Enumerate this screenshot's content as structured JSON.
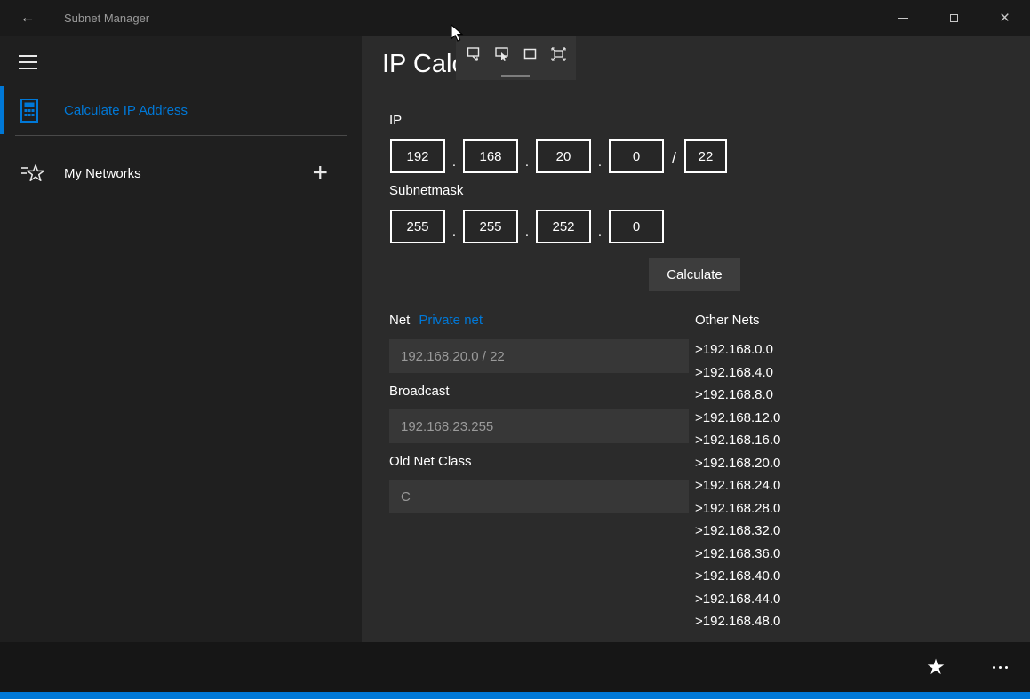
{
  "colors": {
    "accent": "#0078d7"
  },
  "titlebar": {
    "back_glyph": "←",
    "title": "Subnet Manager",
    "close_glyph": "×"
  },
  "sidebar": {
    "items": [
      {
        "label": "Calculate IP Address",
        "selected": true
      },
      {
        "label": "My Networks",
        "selected": false
      }
    ],
    "add_glyph": "+"
  },
  "page": {
    "title": "IP Calc"
  },
  "overlay": {
    "icons": [
      "snip-rectangle-icon",
      "snip-freeform-icon",
      "snip-window-icon",
      "snip-fullscreen-icon"
    ]
  },
  "form": {
    "ip_label": "IP",
    "ip": [
      "192",
      "168",
      "20",
      "0"
    ],
    "cidr": "22",
    "dot": ".",
    "slash": "/",
    "subnet_label": "Subnetmask",
    "mask": [
      "255",
      "255",
      "252",
      "0"
    ],
    "calculate_label": "Calculate"
  },
  "results": {
    "net_label": "Net",
    "private_net_label": "Private net",
    "net_value": "192.168.20.0 / 22",
    "broadcast_label": "Broadcast",
    "broadcast_value": "192.168.23.255",
    "old_net_class_label": "Old Net Class",
    "old_net_class_value": "C"
  },
  "other_nets": {
    "title": "Other Nets",
    "items": [
      ">192.168.0.0",
      ">192.168.4.0",
      ">192.168.8.0",
      ">192.168.12.0",
      ">192.168.16.0",
      ">192.168.20.0",
      ">192.168.24.0",
      ">192.168.28.0",
      ">192.168.32.0",
      ">192.168.36.0",
      ">192.168.40.0",
      ">192.168.44.0",
      ">192.168.48.0"
    ]
  },
  "appbar": {
    "favorite_glyph": "★"
  }
}
